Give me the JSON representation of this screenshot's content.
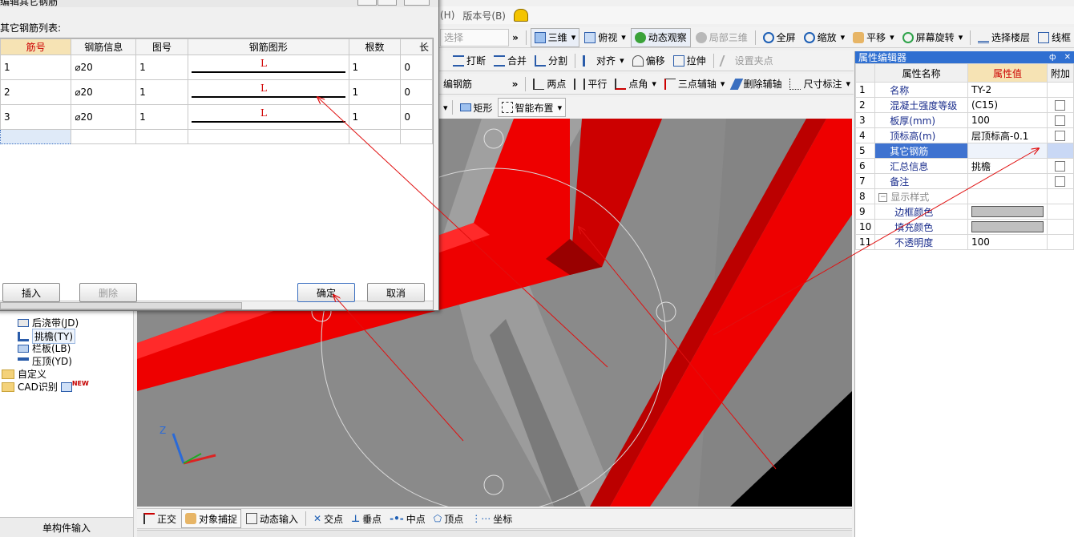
{
  "menu": {
    "help_partial": "(H)",
    "version": "版本号(B)"
  },
  "toolbar1": {
    "select_partial": "选择",
    "view3d": "三维",
    "topview": "俯视",
    "dynamic_observe": "动态观察",
    "local3d": "局部三维",
    "fullscreen": "全屏",
    "zoom": "缩放",
    "pan": "平移",
    "screen_rotate": "屏幕旋转",
    "select_floor": "选择楼层",
    "wireframe": "线框"
  },
  "toolbar2": {
    "break": "打断",
    "merge": "合并",
    "split": "分割",
    "align": "对齐",
    "offset": "偏移",
    "stretch": "拉伸",
    "set_pinch": "设置夹点"
  },
  "toolbar3": {
    "edit_rebar_partial": "编钢筋",
    "two_point": "两点",
    "parallel": "平行",
    "point_angle": "点角",
    "three_point_axis": "三点辅轴",
    "delete_axis": "删除辅轴",
    "dimension": "尺寸标注"
  },
  "toolbar4": {
    "rect": "矩形",
    "smart_layout": "智能布置"
  },
  "dialog": {
    "title": "编辑其它钢筋",
    "list_label": "其它钢筋列表:",
    "columns": [
      "筋号",
      "钢筋信息",
      "图号",
      "钢筋图形",
      "根数",
      "长"
    ],
    "rows": [
      {
        "id": "1",
        "info": "⌀20",
        "fig": "1",
        "shape": "L",
        "count": "1",
        "len": "0"
      },
      {
        "id": "2",
        "info": "⌀20",
        "fig": "1",
        "shape": "L",
        "count": "1",
        "len": "0"
      },
      {
        "id": "3",
        "info": "⌀20",
        "fig": "1",
        "shape": "L",
        "count": "1",
        "len": "0"
      }
    ],
    "insert": "插入",
    "delete": "删除",
    "ok": "确定",
    "cancel": "取消"
  },
  "property_editor": {
    "title": "属性编辑器",
    "pin": "ф",
    "close": "✕",
    "headers": {
      "name": "属性名称",
      "value": "属性值",
      "extra": "附加"
    },
    "rows": [
      {
        "n": "1",
        "name": "名称",
        "value": "TY-2",
        "chk": false
      },
      {
        "n": "2",
        "name": "混凝土强度等级",
        "value": "(C15)",
        "chk": true
      },
      {
        "n": "3",
        "name": "板厚(mm)",
        "value": "100",
        "chk": true
      },
      {
        "n": "4",
        "name": "顶标高(m)",
        "value": "层顶标高-0.1",
        "chk": true
      },
      {
        "n": "5",
        "name": "其它钢筋",
        "value": "",
        "chk": false,
        "selected": true
      },
      {
        "n": "6",
        "name": "汇总信息",
        "value": "挑檐",
        "chk": true
      },
      {
        "n": "7",
        "name": "备注",
        "value": "",
        "chk": true
      },
      {
        "n": "8",
        "name": "显示样式",
        "value": "",
        "chk": false,
        "group": true
      },
      {
        "n": "9",
        "name": "边框颜色",
        "value": "",
        "chk": false,
        "swatch": true
      },
      {
        "n": "10",
        "name": "填充颜色",
        "value": "",
        "chk": false,
        "swatch": true
      },
      {
        "n": "11",
        "name": "不透明度",
        "value": "100",
        "chk": false
      }
    ]
  },
  "tree": {
    "items": [
      {
        "label": "后浇带(JD)"
      },
      {
        "label": "挑檐(TY)"
      },
      {
        "label": "栏板(LB)"
      },
      {
        "label": "压顶(YD)"
      }
    ],
    "folders": [
      {
        "label": "自定义"
      },
      {
        "label": "CAD识别"
      }
    ],
    "new_badge": "NEW",
    "bottom_button": "单构件输入"
  },
  "statusbar": {
    "ortho": "正交",
    "snap": "对象捕捉",
    "dyn_input": "动态输入",
    "intersection": "交点",
    "perpendicular": "垂点",
    "midpoint": "中点",
    "vertex": "顶点",
    "coordinate": "坐标"
  },
  "viewport": {
    "axis_z": "Z"
  },
  "colors": {
    "beam_red": "#ee0000",
    "annotation": "#e01010",
    "viewport_bg": "#8e8e8e",
    "selected_row": "#c9d8f5",
    "panel_header": "#e8e8e8"
  }
}
